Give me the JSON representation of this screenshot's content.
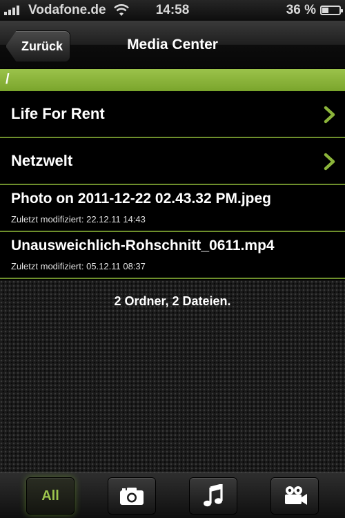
{
  "status_bar": {
    "carrier": "Vodafone.de",
    "time": "14:58",
    "battery": "36 %",
    "battery_level": 0.36
  },
  "nav": {
    "back_label": "Zurück",
    "title": "Media Center"
  },
  "path": "/",
  "items": [
    {
      "type": "folder",
      "name": "Life For Rent"
    },
    {
      "type": "folder",
      "name": "Netzwelt"
    },
    {
      "type": "file",
      "name": "Photo on 2011-12-22 02.43.32 PM.jpeg",
      "meta": "Zuletzt modifiziert: 22.12.11 14:43"
    },
    {
      "type": "file",
      "name": "Unausweichlich-Rohschnitt_0611.mp4",
      "meta": "Zuletzt modifiziert: 05.12.11 08:37"
    }
  ],
  "summary": "2 Ordner, 2 Dateien.",
  "tabs": [
    {
      "label": "All",
      "icon": "all",
      "active": true
    },
    {
      "label": "",
      "icon": "camera-icon",
      "active": false
    },
    {
      "label": "",
      "icon": "music-note-icon",
      "active": false
    },
    {
      "label": "",
      "icon": "video-camera-icon",
      "active": false
    }
  ],
  "colors": {
    "accent_green": "#8bb43a",
    "separator_green": "#6e8f2c"
  }
}
